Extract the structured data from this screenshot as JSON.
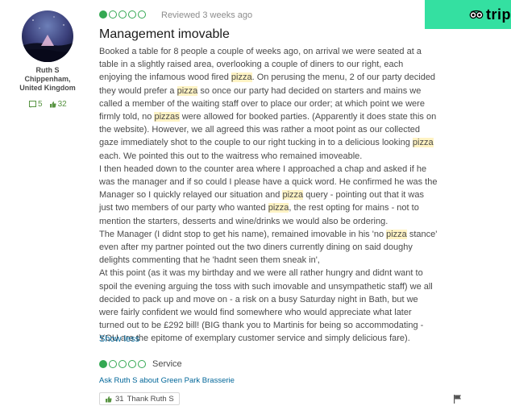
{
  "brand": {
    "icon": "tripadvisor-owl-icon",
    "text": "trip",
    "color": "#34e0a1"
  },
  "reviewer": {
    "name": "Ruth S",
    "location": "Chippenham, United Kingdom",
    "reviews_count": "5",
    "helpful_count": "32"
  },
  "review": {
    "rating": 1,
    "rating_max": 5,
    "reviewed": "Reviewed 3 weeks ago",
    "title": "Management imovable",
    "paragraphs": [
      [
        {
          "t": "Booked a table for 8 people a couple of weeks ago, on arrival we were seated at a table in a slightly raised area, overlooking a couple of diners to our right, each enjoying the infamous wood fired "
        },
        {
          "t": "pizza",
          "h": true
        },
        {
          "t": ". On perusing the menu, 2 of our party decided they would prefer a "
        },
        {
          "t": "pizza",
          "h": true
        },
        {
          "t": " so once our party had decided on starters and mains we called a member of the waiting staff over to place our order; at which point we were firmly told, no "
        },
        {
          "t": "pizzas",
          "h": true
        },
        {
          "t": " were allowed for booked parties. (Apparently it does state this on the website). However, we all agreed this was rather a moot point as our collected gaze immediately shot to the couple to our right tucking in to a delicious looking "
        },
        {
          "t": "pizza",
          "h": true
        },
        {
          "t": " each. We pointed this out to the waitress who remained imoveable."
        }
      ],
      [
        {
          "t": "I then headed down to the counter area where I approached a chap and asked if he was the manager and if so could I please have a quick word. He confirmed he was the Manager so I quickly relayed our situation and "
        },
        {
          "t": "pizza",
          "h": true
        },
        {
          "t": " query - pointing out that it was just two members of our party who wanted "
        },
        {
          "t": "pizza",
          "h": true
        },
        {
          "t": ", the rest opting for mains - not to mention the starters, desserts and wine/drinks we would also be ordering."
        }
      ],
      [
        {
          "t": "The Manager (I didnt stop to get his name), remained imovable in his 'no "
        },
        {
          "t": "pizza",
          "h": true
        },
        {
          "t": " stance' even after my partner pointed out the two diners currently dining on said doughy delights commenting that he 'hadnt seen them sneak in',"
        }
      ],
      [
        {
          "t": "At this point (as it was my birthday and we were all rather hungry and didnt want to spoil the evening arguing the toss with such imovable and unsympathetic staff) we all decided to pack up and move on - a risk on a busy Saturday night in Bath, but we were fairly confident we would find somewhere who would appreciate what later turned out to be £292 bill! (BIG thank you to Martinis for being so accommodating - YOU are the epitome of exemplary customer service and simply delicious fare)."
        }
      ]
    ],
    "show_less": "Show less",
    "service_label": "Service",
    "service_rating": 1,
    "ask_link": "Ask Ruth S about Green Park Brasserie",
    "thank_count": "31",
    "thank_label": "Thank Ruth S"
  }
}
